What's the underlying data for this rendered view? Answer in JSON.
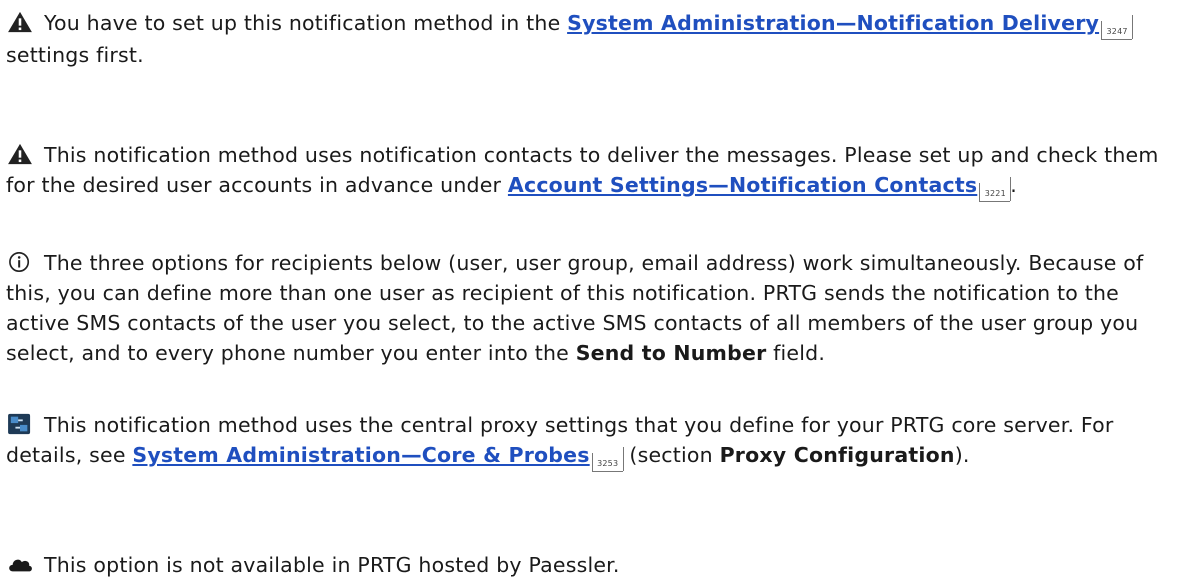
{
  "notes": [
    {
      "icon": "warning-icon",
      "pre": "You have to set up this notification method in the ",
      "link": "System Administration—Notification Delivery",
      "ref": "3247",
      "post": " settings first."
    },
    {
      "icon": "warning-icon",
      "pre": "This notification method uses notification contacts to deliver the messages. Please set up and check them for the desired user accounts in advance under ",
      "link": "Account Settings—Notification Contacts",
      "ref": "3221",
      "post": "."
    },
    {
      "icon": "info-icon",
      "pre": "The three options for recipients below (user, user group, email address) work simultaneously. Because of this, you can define more than one user as recipient of this notification. PRTG sends the notification to the active SMS contacts of the user you select, to the active SMS contacts of all members of the user group you select, and to every phone number you enter into the ",
      "bold": "Send to Number",
      "post": " field."
    },
    {
      "icon": "proxy-icon",
      "pre": "This notification method uses the central proxy settings that you define for your PRTG core server. For details, see ",
      "link": "System Administration—Core & Probes",
      "ref": "3253",
      "mid": " (section ",
      "bold": "Proxy Configuration",
      "post": ")."
    },
    {
      "icon": "cloud-icon",
      "pre": "This option is not available in PRTG hosted by Paessler."
    }
  ]
}
